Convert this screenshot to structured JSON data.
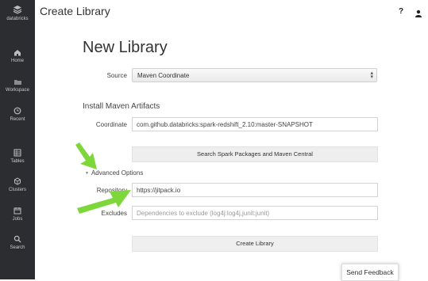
{
  "sidebar": {
    "brand_label": "databricks",
    "items": [
      {
        "label": "Home",
        "icon": "home-icon"
      },
      {
        "label": "Workspace",
        "icon": "folder-icon"
      },
      {
        "label": "Recent",
        "icon": "clock-icon"
      },
      {
        "label": "Tables",
        "icon": "table-icon"
      },
      {
        "label": "Clusters",
        "icon": "cluster-icon"
      },
      {
        "label": "Jobs",
        "icon": "calendar-icon"
      },
      {
        "label": "Search",
        "icon": "search-icon"
      }
    ]
  },
  "header": {
    "title": "Create Library",
    "help_glyph": "?",
    "user_icon": "user-icon"
  },
  "form": {
    "title": "New Library",
    "source_label": "Source",
    "source_value": "Maven Coordinate",
    "section_title": "Install Maven Artifacts",
    "coordinate_label": "Coordinate",
    "coordinate_value": "com.github.databricks:spark-redshift_2.10:master-SNAPSHOT",
    "search_button": "Search Spark Packages and Maven Central",
    "advanced_label": "Advanced Options",
    "repository_label": "Repository",
    "repository_value": "https://jitpack.io",
    "excludes_label": "Excludes",
    "excludes_placeholder": "Dependencies to exclude (log4j:log4j,junit:junit)",
    "create_button": "Create Library"
  },
  "feedback_button": "Send Feedback",
  "colors": {
    "sidebar_bg": "#2c2d30",
    "annotation_arrow": "#7dd63a",
    "button_bg": "#eeeeee"
  }
}
